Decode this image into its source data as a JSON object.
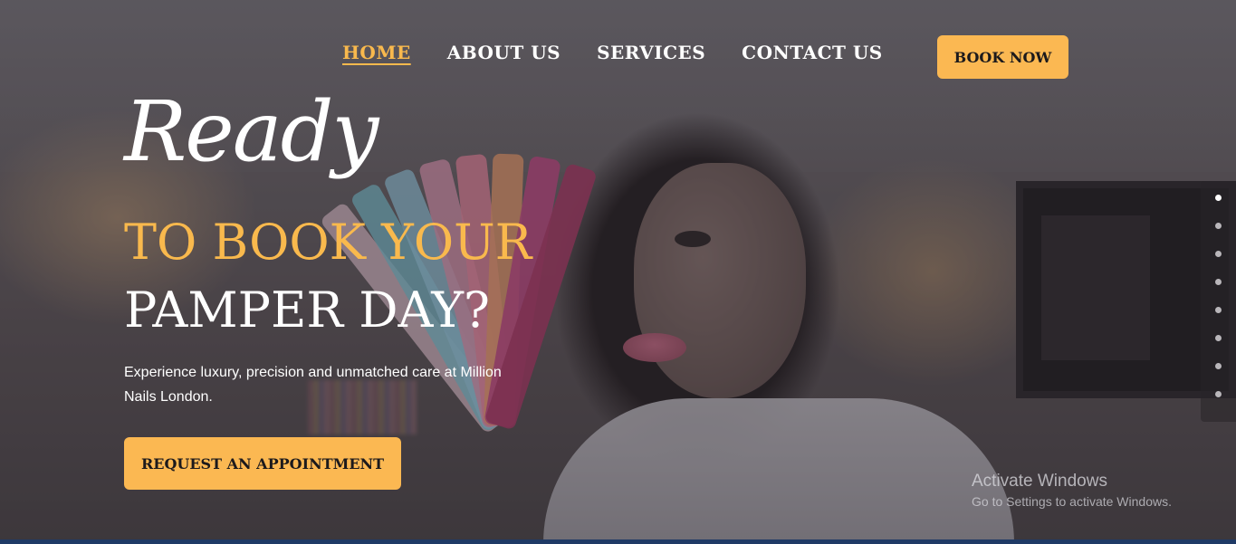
{
  "nav": {
    "items": [
      {
        "label": "HOME",
        "active": true
      },
      {
        "label": "ABOUT US",
        "active": false
      },
      {
        "label": "SERVICES",
        "active": false
      },
      {
        "label": "CONTACT US",
        "active": false
      }
    ]
  },
  "header": {
    "book_now_label": "BOOK NOW"
  },
  "hero": {
    "script_word": "Ready",
    "line_gold": "TO BOOK YOUR",
    "line_white": "PAMPER DAY?",
    "description": "Experience luxury, precision and unmatched care at Million Nails London.",
    "cta_label": "REQUEST AN APPOINTMENT"
  },
  "slider": {
    "total": 8,
    "active_index": 0
  },
  "watermark": {
    "title": "Activate Windows",
    "subtitle": "Go to Settings to activate Windows."
  },
  "colors": {
    "accent": "#fbb852",
    "gold_text": "#f9b94d",
    "bottom_bar": "#1f3a66"
  }
}
